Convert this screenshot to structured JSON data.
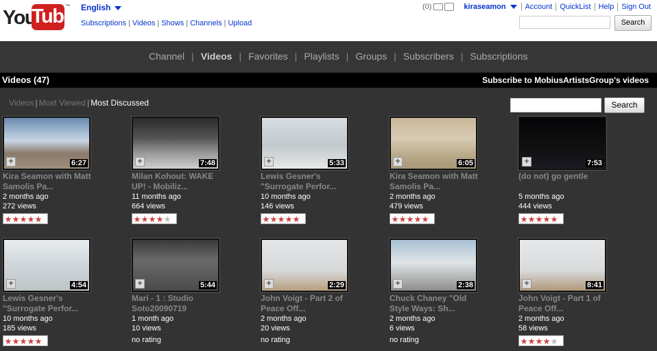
{
  "header": {
    "logo_you": "You",
    "logo_tube": "Tube",
    "logo_tm": "™",
    "language": "English",
    "links": [
      "Subscriptions",
      "Videos",
      "Shows",
      "Channels",
      "Upload"
    ],
    "inbox_count": "(0)",
    "username": "kiraseamon",
    "account_links": [
      "Account",
      "QuickList",
      "Help",
      "Sign Out"
    ],
    "search_button": "Search"
  },
  "channel_nav": {
    "items": [
      "Channel",
      "Videos",
      "Favorites",
      "Playlists",
      "Groups",
      "Subscribers",
      "Subscriptions"
    ],
    "active": "Videos"
  },
  "section": {
    "title": "Videos (47)",
    "subscribe": "Subscribe to MobiusArtistsGroup's videos"
  },
  "filters": {
    "videos": "Videos",
    "most_viewed": "Most Viewed",
    "most_discussed": "Most Discussed",
    "search_button": "Search"
  },
  "videos": [
    {
      "title": "Kira Seamon with Matt Samolis Pa...",
      "age": "2 months ago",
      "views": "272 views",
      "duration": "6:27",
      "stars": 5
    },
    {
      "title": "Milan Kohout: WAKE UP! - Mobiliz...",
      "age": "11 months ago",
      "views": "664 views",
      "duration": "7:48",
      "stars": 4
    },
    {
      "title": "Lewis Gesner's \"Surrogate Perfor...",
      "age": "10 months ago",
      "views": "146 views",
      "duration": "5:33",
      "stars": 5
    },
    {
      "title": "Kira Seamon with Matt Samolis Pa...",
      "age": "2 months ago",
      "views": "479 views",
      "duration": "6:05",
      "stars": 5
    },
    {
      "title": "(do not) go gentle",
      "age": "5 months ago",
      "views": "444 views",
      "duration": "7:53",
      "stars": 5
    },
    {
      "title": "Lewis Gesner's \"Surrogate Perfor...",
      "age": "10 months ago",
      "views": "185 views",
      "duration": "4:54",
      "stars": 5
    },
    {
      "title": "Mari - 1 : Studio Soto20090719",
      "age": "1 month ago",
      "views": "10 views",
      "duration": "5:44",
      "stars": 0,
      "rating_text": "no rating"
    },
    {
      "title": "John Voigt - Part 2 of Peace Off...",
      "age": "2 months ago",
      "views": "20 views",
      "duration": "2:29",
      "stars": 0,
      "rating_text": "no rating"
    },
    {
      "title": "Chuck Chaney \"Old Style Ways: Sh...",
      "age": "2 months ago",
      "views": "6 views",
      "duration": "2:38",
      "stars": 0,
      "rating_text": "no rating"
    },
    {
      "title": "John Voigt - Part 1 of Peace Off...",
      "age": "2 months ago",
      "views": "58 views",
      "duration": "8:41",
      "stars": 4
    }
  ],
  "colors": {
    "page_bg": "#333333",
    "link_blue": "#0033cc",
    "logo_red": "#d01f1f",
    "star_red": "#cc4444"
  }
}
